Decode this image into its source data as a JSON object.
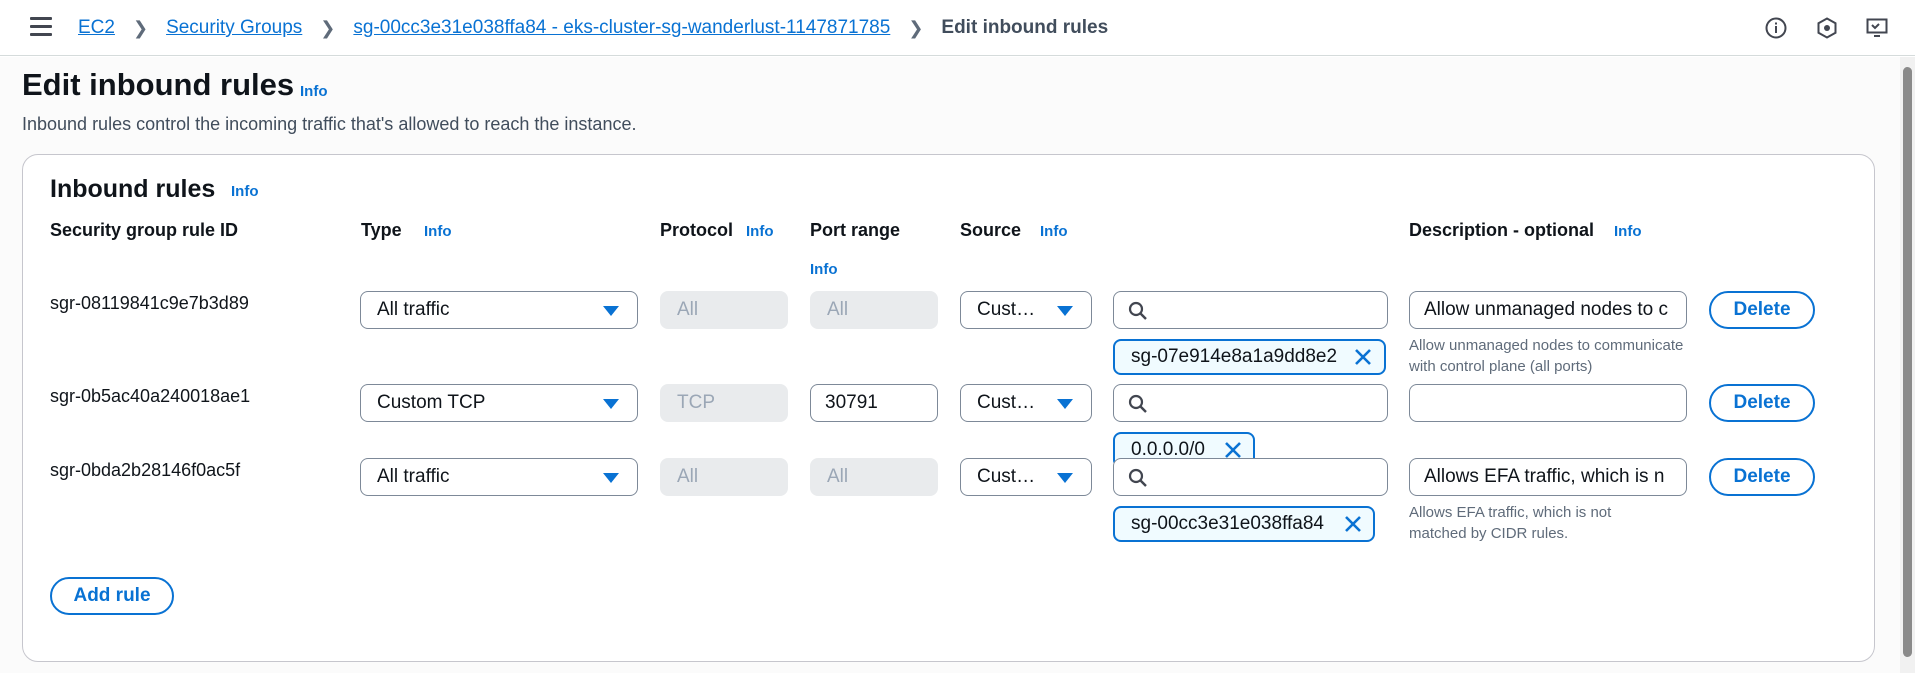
{
  "breadcrumb": {
    "items": [
      "EC2",
      "Security Groups",
      "sg-00cc3e31e038ffa84 - eks-cluster-sg-wanderlust-1147871785"
    ],
    "current": "Edit inbound rules"
  },
  "header_icons": [
    "info-circle-icon",
    "settings-hexagon-icon",
    "display-icon"
  ],
  "page": {
    "title": "Edit inbound rules",
    "title_info": "Info",
    "description": "Inbound rules control the incoming traffic that's allowed to reach the instance."
  },
  "card": {
    "title": "Inbound rules",
    "info": "Info"
  },
  "columns": {
    "rule_id": "Security group rule ID",
    "type": "Type",
    "type_info": "Info",
    "protocol": "Protocol",
    "protocol_info": "Info",
    "port_range": "Port range",
    "port_info": "Info",
    "source": "Source",
    "source_info": "Info",
    "description": "Description - optional",
    "description_info": "Info"
  },
  "rules": [
    {
      "id": "sgr-08119841c9e7b3d89",
      "type": "All traffic",
      "protocol": "All",
      "port_range": "All",
      "source_type": "Cust…",
      "source_search": "",
      "source_token": "sg-07e914e8a1a9dd8e2",
      "description": "Allow unmanaged nodes to c",
      "description_full": "Allow unmanaged nodes to communicate with control plane (all ports)",
      "delete": "Delete"
    },
    {
      "id": "sgr-0b5ac40a240018ae1",
      "type": "Custom TCP",
      "protocol": "TCP",
      "port_range": "30791",
      "source_type": "Cust…",
      "source_search": "",
      "source_token": "0.0.0.0/0",
      "description": "",
      "description_full": "",
      "delete": "Delete"
    },
    {
      "id": "sgr-0bda2b28146f0ac5f",
      "type": "All traffic",
      "protocol": "All",
      "port_range": "All",
      "source_type": "Cust…",
      "source_search": "",
      "source_token": "sg-00cc3e31e038ffa84",
      "description": "Allows EFA traffic, which is n",
      "description_full": "Allows EFA traffic, which is not matched by CIDR rules.",
      "delete": "Delete"
    }
  ],
  "add_rule": "Add rule",
  "colors": {
    "accent": "#0972d3",
    "text": "#0f141a",
    "muted": "#5f6b7a",
    "disabled_bg": "#e9ebed"
  }
}
